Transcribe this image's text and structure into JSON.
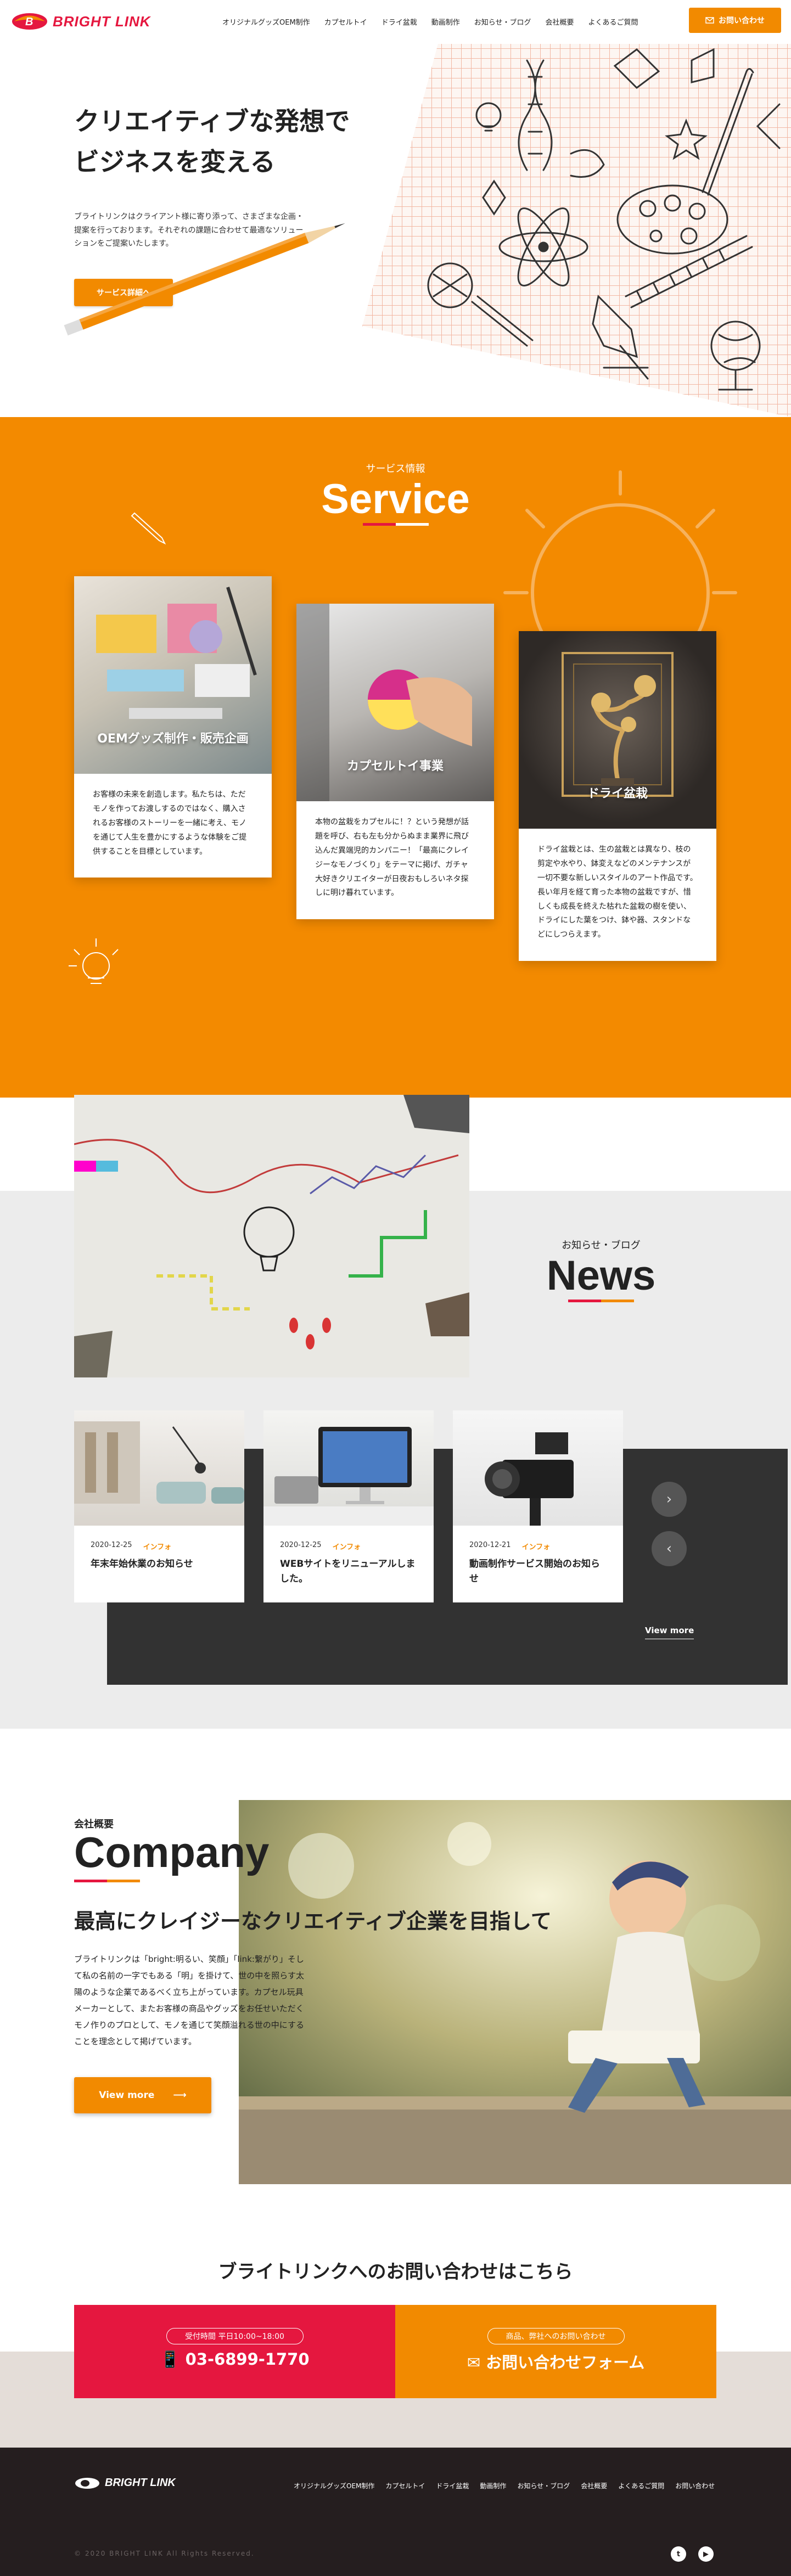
{
  "header": {
    "logo_text": "BRIGHT LINK",
    "nav": [
      "オリジナルグッズOEM制作",
      "カプセルトイ",
      "ドライ盆栽",
      "動画制作",
      "お知らせ・ブログ",
      "会社概要",
      "よくあるご質問"
    ],
    "contact_button": "お問い合わせ"
  },
  "hero": {
    "title_line1": "クリエイティブな発想で",
    "title_line2": "ビジネスを変える",
    "text": "ブライトリンクはクライアント様に寄り添って、さまざまな企画・提案を行っております。それぞれの課題に合わせて最適なソリューションをご提案いたします。",
    "button": "サービス詳細へ"
  },
  "service": {
    "sub": "サービス情報",
    "title": "Service",
    "cards": [
      {
        "label": "OEMグッズ制作・販売企画",
        "text": "お客様の未来を創造します。私たちは、ただモノを作ってお渡しするのではなく、購入されるお客様のストーリーを一緒に考え、モノを通じて人生を豊かにするような体験をご提供することを目標としています。"
      },
      {
        "label": "カプセルトイ事業",
        "text": "本物の盆栽をカプセルに！？という発想が話題を呼び、右も左も分からぬまま業界に飛び込んだ異端児的カンパニー！「最高にクレイジーなモノづくり」をテーマに掲げ、ガチャ大好きクリエイターが日夜おもしろいネタ探しに明け暮れています。"
      },
      {
        "label": "ドライ盆栽",
        "text": "ドライ盆栽とは、生の盆栽とは異なり、枝の剪定や水やり、鉢変えなどのメンテナンスが一切不要な新しいスタイルのアート作品です。長い年月を経て育った本物の盆栽ですが、惜しくも成長を終えた枯れた盆栽の樹を使い、ドライにした葉をつけ、鉢や器、スタンドなどにしつらえます。"
      }
    ]
  },
  "news": {
    "sub": "お知らせ・ブログ",
    "title": "News",
    "items": [
      {
        "date": "2020-12-25",
        "category": "インフォ",
        "title": "年末年始休業のお知らせ"
      },
      {
        "date": "2020-12-25",
        "category": "インフォ",
        "title": "WEBサイトをリニューアルしました。"
      },
      {
        "date": "2020-12-21",
        "category": "インフォ",
        "title": "動画制作サービス開始のお知らせ"
      }
    ],
    "next_icon": "chevron-right-icon",
    "prev_icon": "chevron-left-icon",
    "view_more": "View more"
  },
  "company": {
    "sub": "会社概要",
    "title": "Company",
    "heading": "最高にクレイジーなクリエイティブ企業を目指して",
    "text": "ブライトリンクは「bright:明るい、笑顔」「link:繋がり」そして私の名前の一字でもある「明」を掛けて、世の中を照らす太陽のような企業であるべく立ち上がっています。カプセル玩具メーカーとして、またお客様の商品やグッズをお任せいただくモノ作りのプロとして、モノを通じて笑顔溢れる世の中にすることを理念として掲げています。",
    "button": "View more"
  },
  "contact": {
    "title": "ブライトリンクへのお問い合わせはこちら",
    "phone_pill": "受付時間 平日10:00~18:00",
    "phone": "03-6899-1770",
    "form_pill": "商品、弊社へのお問い合わせ",
    "form": "お問い合わせフォーム"
  },
  "footer": {
    "logo_text": "BRIGHT LINK",
    "nav": [
      "オリジナルグッズOEM制作",
      "カプセルトイ",
      "ドライ盆栽",
      "動画制作",
      "お知らせ・ブログ",
      "会社概要",
      "よくあるご質問",
      "お問い合わせ"
    ],
    "copyright": "© 2020 BRIGHT LINK All Rights Reserved.",
    "twitter_icon": "twitter-icon",
    "youtube_icon": "youtube-icon"
  },
  "colors": {
    "accent": "#f28a00",
    "red": "#e5173f",
    "dark": "#251e1f"
  }
}
